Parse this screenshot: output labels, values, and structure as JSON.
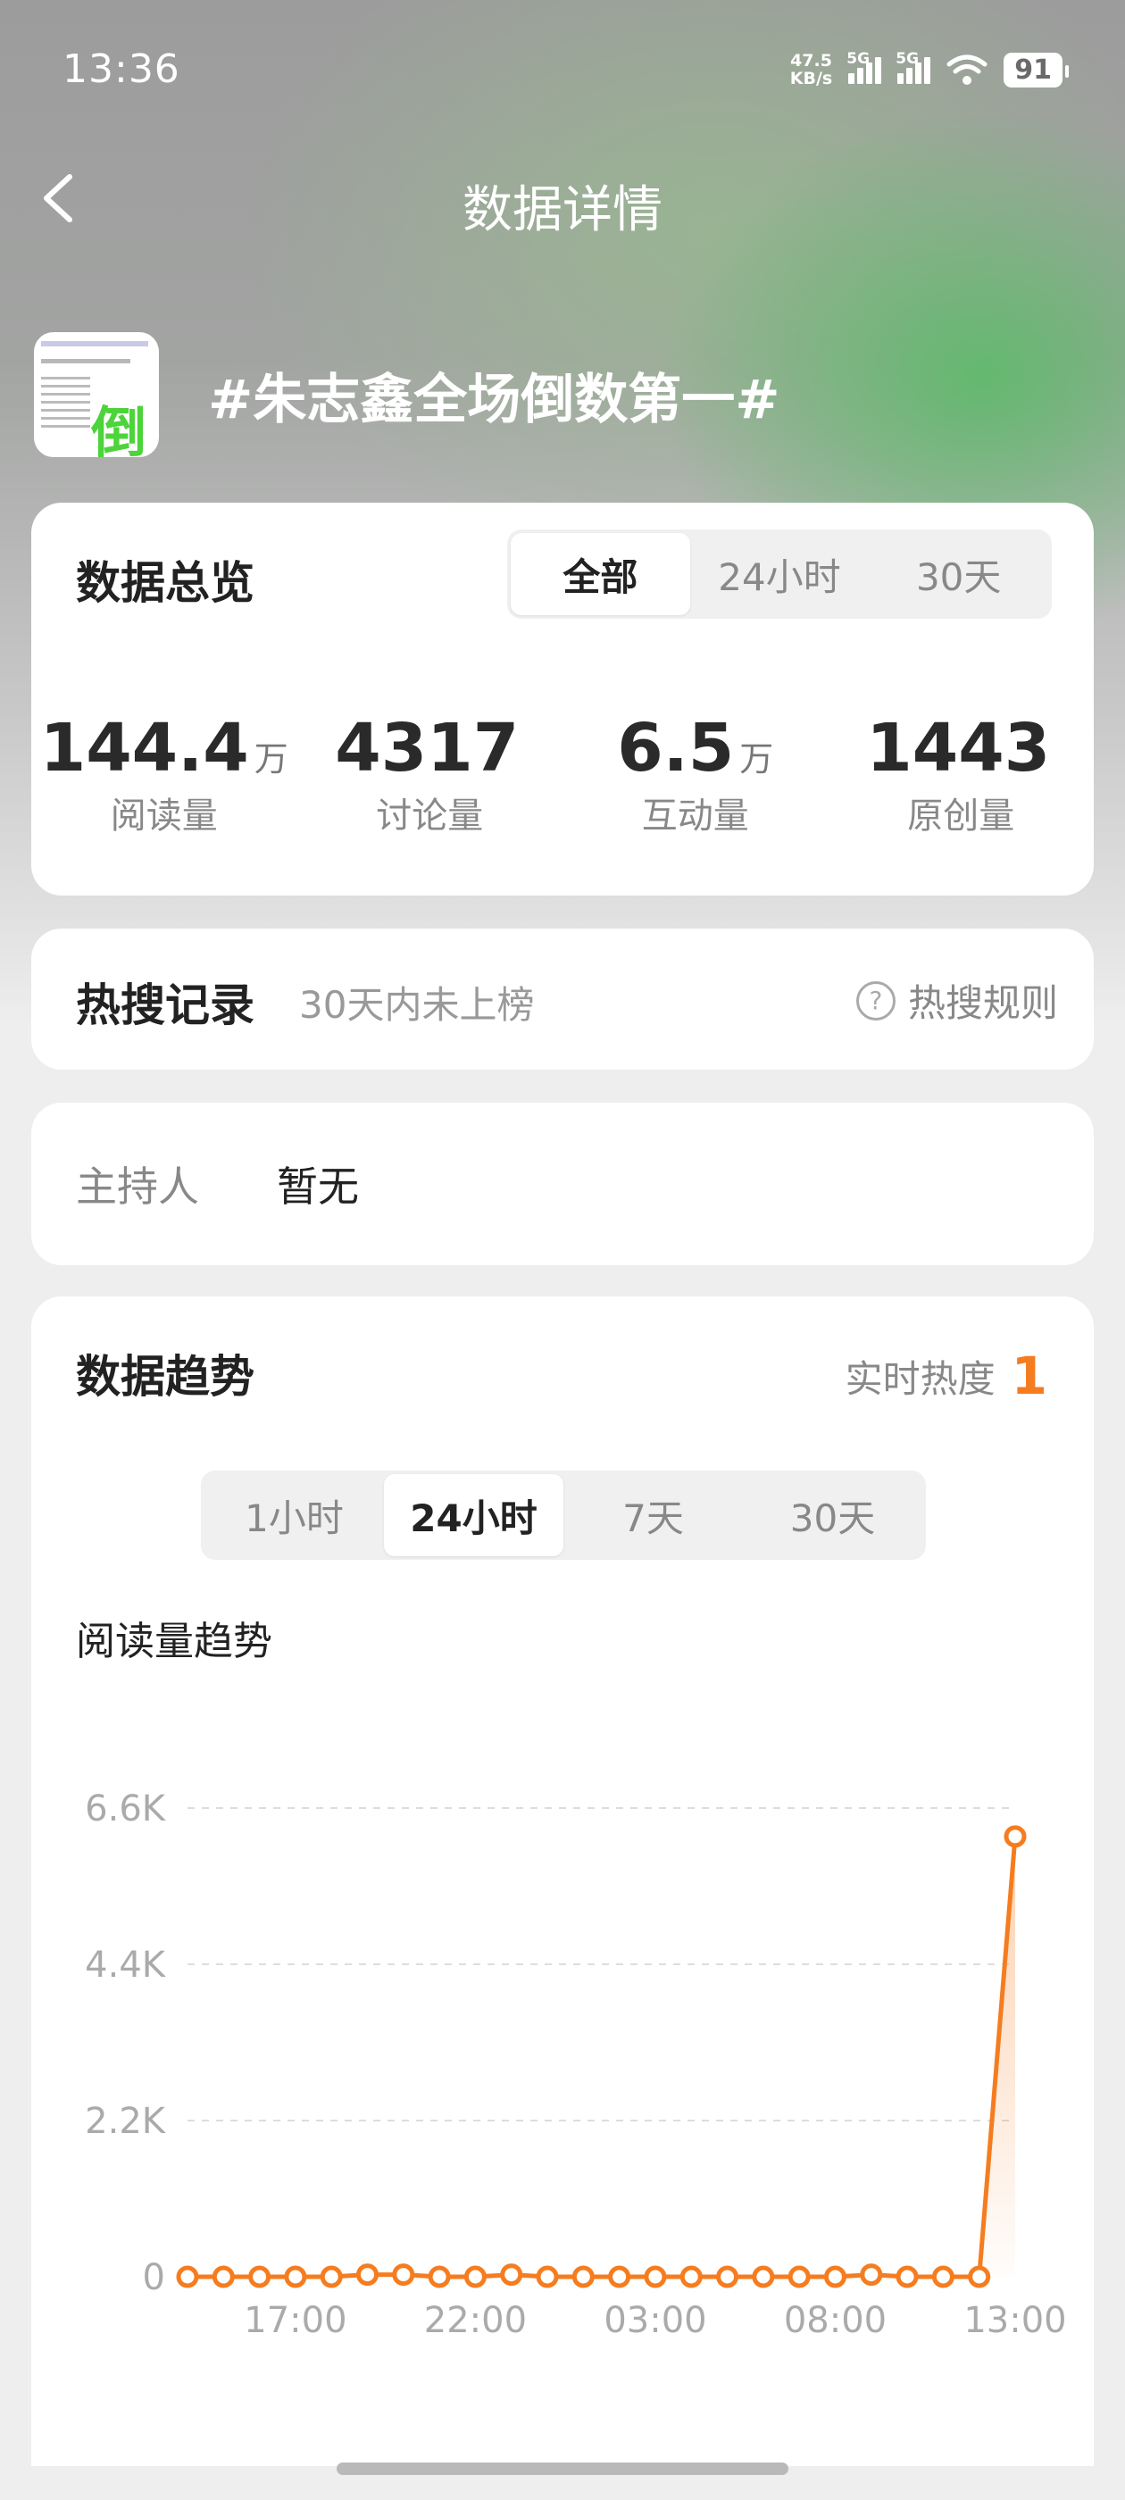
{
  "status": {
    "time": "13:36",
    "net_speed": "47.5",
    "net_unit": "KB/s",
    "sig1": "5G",
    "sig2": "5G",
    "battery": "91"
  },
  "nav": {
    "title": "数据详情"
  },
  "topic": {
    "title": "#朱志鑫全场倒数第一#",
    "thumb_char": "倒"
  },
  "overview": {
    "title": "数据总览",
    "tabs": [
      "全部",
      "24小时",
      "30天"
    ],
    "selected_tab": "全部",
    "stats": [
      {
        "value": "144.4",
        "unit": "万",
        "label": "阅读量"
      },
      {
        "value": "4317",
        "unit": "",
        "label": "讨论量"
      },
      {
        "value": "6.5",
        "unit": "万",
        "label": "互动量"
      },
      {
        "value": "1443",
        "unit": "",
        "label": "原创量"
      }
    ]
  },
  "hot_search": {
    "title": "热搜记录",
    "status": "30天内未上榜",
    "rule_label": "热搜规则"
  },
  "host": {
    "label": "主持人",
    "value": "暂无"
  },
  "trend": {
    "title": "数据趋势",
    "heat_label": "实时热度",
    "heat_value": "1",
    "tabs": [
      "1小时",
      "24小时",
      "7天",
      "30天"
    ],
    "selected_tab": "24小时",
    "subtitle": "阅读量趋势",
    "accent": "#f57c1f"
  },
  "chart_data": {
    "type": "line",
    "title": "阅读量趋势",
    "xlabel": "",
    "ylabel": "",
    "ytick_labels": [
      "0",
      "2.2K",
      "4.4K",
      "6.6K"
    ],
    "ylim": [
      0,
      6600
    ],
    "xtick_labels": [
      "17:00",
      "22:00",
      "03:00",
      "08:00",
      "13:00"
    ],
    "xtick_index": [
      3,
      8,
      13,
      18,
      23
    ],
    "x_count": 24,
    "values": [
      0,
      0,
      0,
      0,
      0,
      30,
      30,
      0,
      0,
      30,
      0,
      0,
      0,
      0,
      0,
      0,
      0,
      0,
      0,
      30,
      0,
      0,
      0,
      6200
    ],
    "grid": true,
    "series_color": "#f57c1f"
  }
}
